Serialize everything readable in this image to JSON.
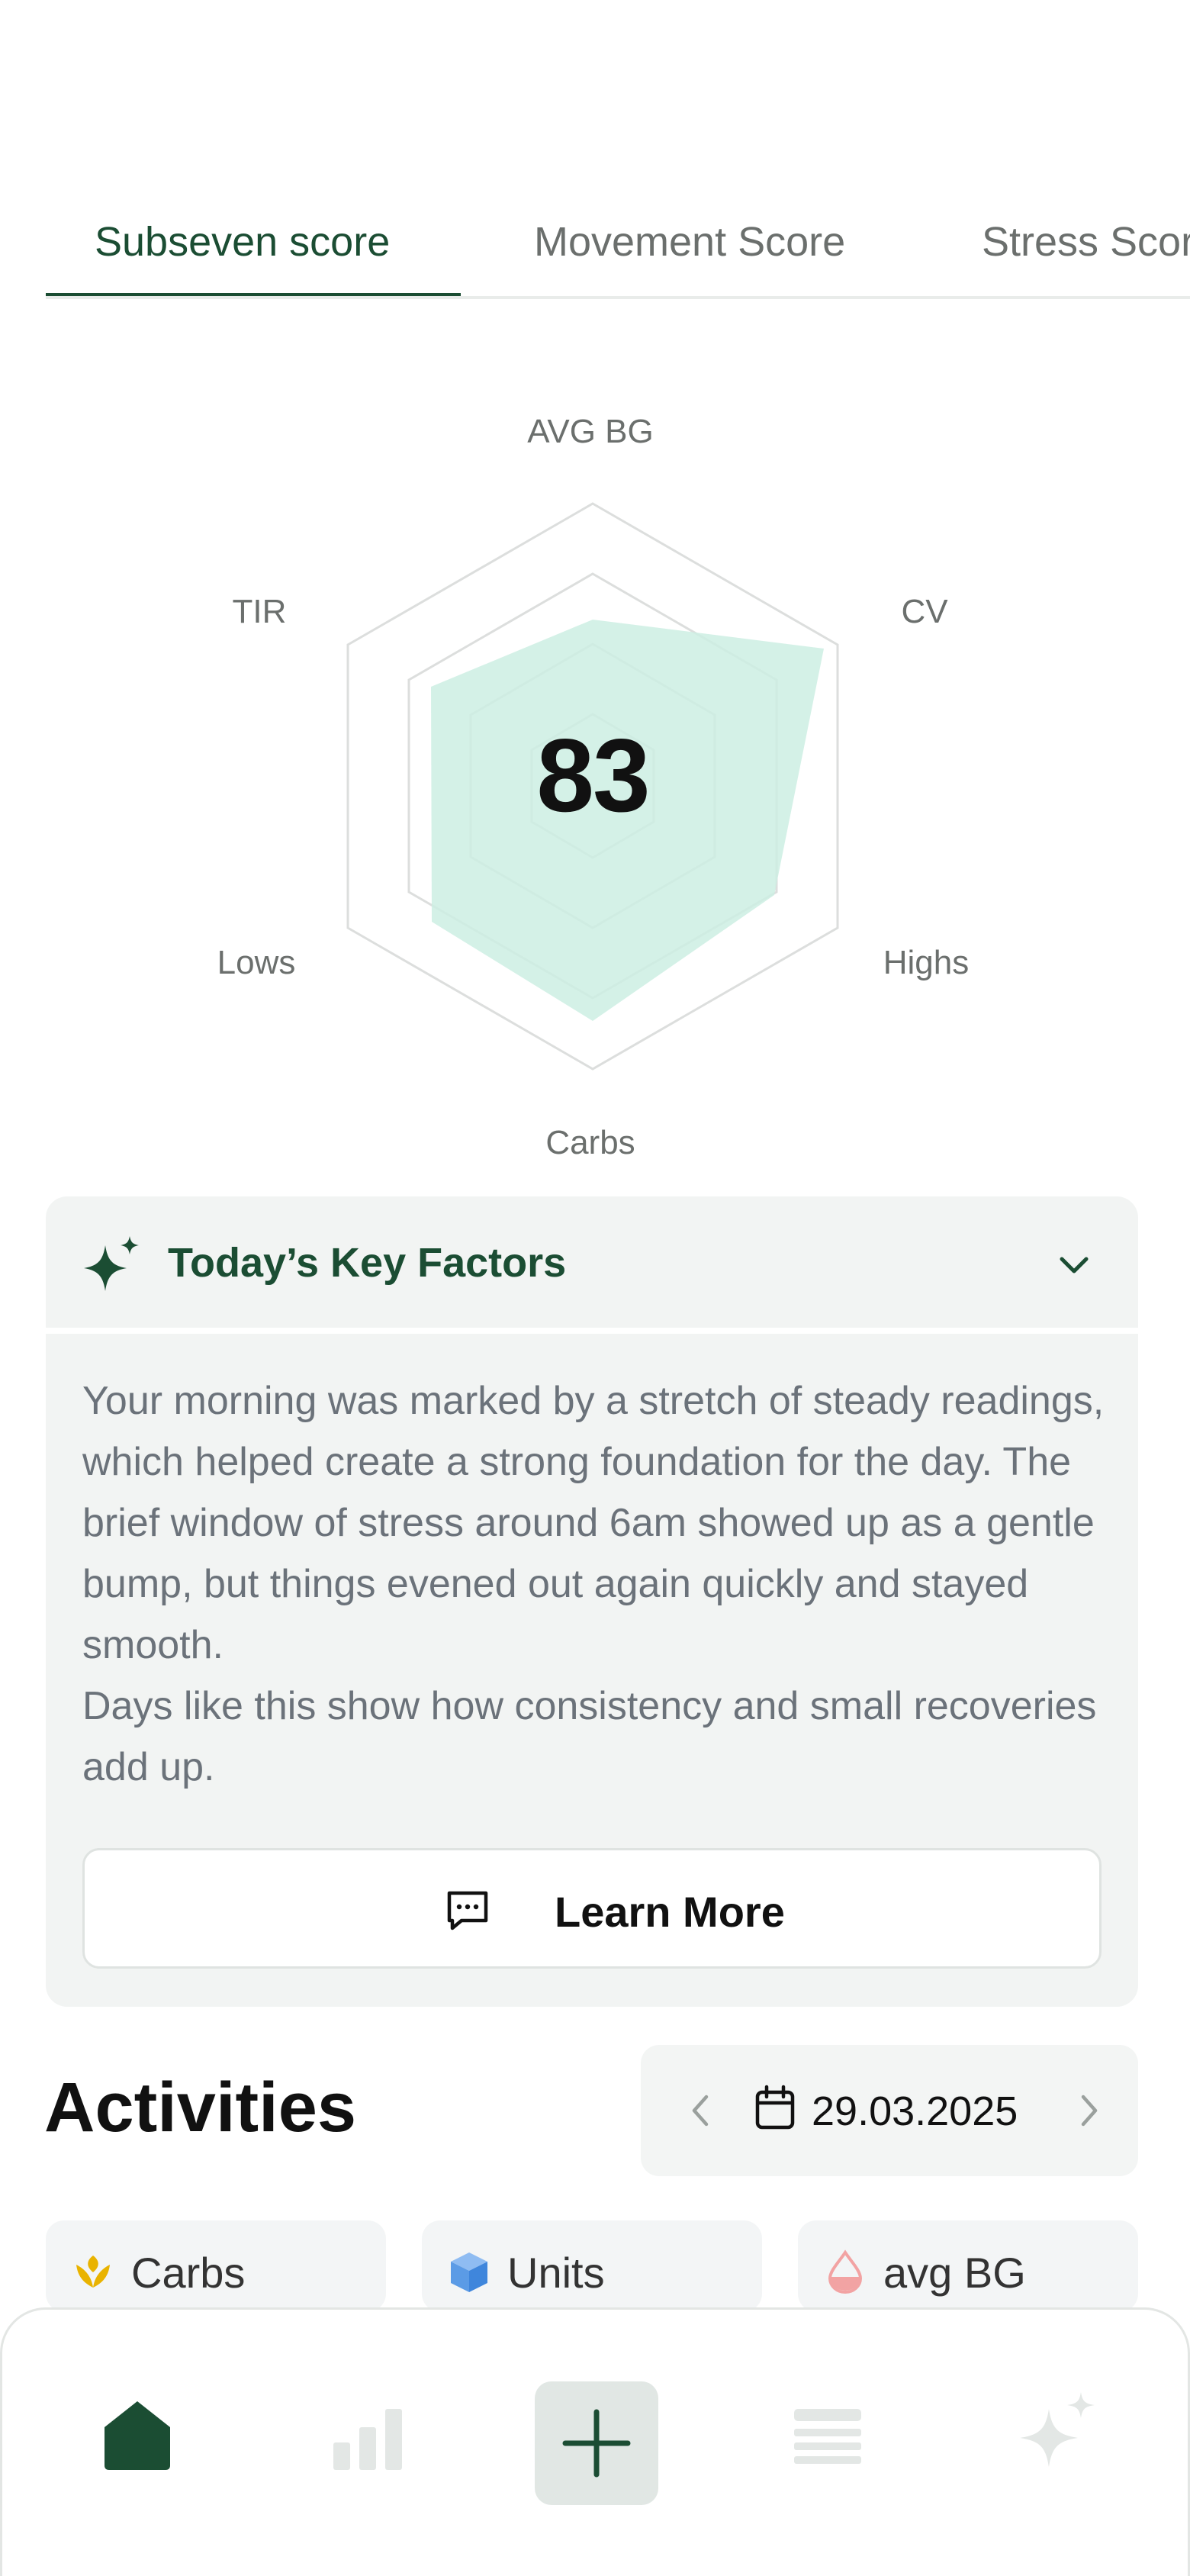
{
  "tabs": [
    {
      "label": "Subseven score",
      "active": true
    },
    {
      "label": "Movement Score",
      "active": false
    },
    {
      "label": "Stress Score",
      "active": false
    }
  ],
  "radar": {
    "score": "83",
    "axes": [
      "AVG BG",
      "CV",
      "Highs",
      "Carbs",
      "Lows",
      "TIR"
    ],
    "fill_color": "#cdeee3"
  },
  "key_factors": {
    "title": "Today’s Key Factors",
    "paragraph1": "Your morning was marked by a stretch of steady readings, which helped create a strong foundation for the day. The brief window of stress around 6am showed up as a gentle bump, but things evened out again quickly and stayed smooth.",
    "paragraph2": "Days like this show how consistency and small recoveries add up.",
    "learn_more": "Learn More",
    "icon": "sparkle-icon"
  },
  "activities": {
    "title": "Activities",
    "date": "29.03.2025",
    "chips": [
      {
        "label": "Carbs",
        "icon": "wheat-icon",
        "color": "#e9b300"
      },
      {
        "label": "Units",
        "icon": "cube-icon",
        "color": "#5b9be6"
      },
      {
        "label": "avg BG",
        "icon": "drop-icon",
        "color": "#f2a3a3"
      }
    ]
  },
  "nav": {
    "items": [
      "home-icon",
      "bar-chart-icon",
      "plus-icon",
      "list-icon",
      "sparkle-icon"
    ],
    "active": "home-icon",
    "accent": "#1b4d33"
  }
}
